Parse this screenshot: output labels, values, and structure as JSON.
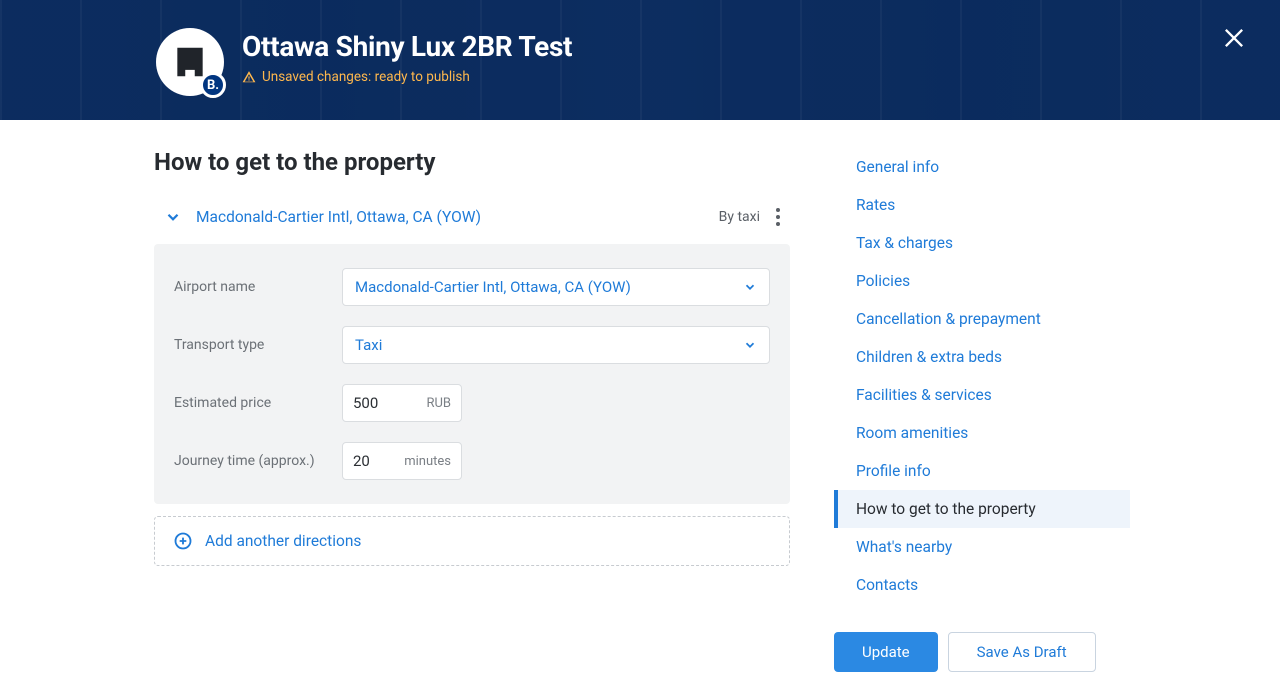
{
  "header": {
    "title": "Ottawa Shiny Lux 2BR Test",
    "status": "Unsaved changes: ready to publish",
    "brand_letter": "B."
  },
  "page": {
    "title": "How to get to the property"
  },
  "direction": {
    "label": "Macdonald-Cartier Intl, Ottawa, CA (YOW)",
    "mode_summary": "By taxi",
    "fields": {
      "airport_label": "Airport name",
      "airport_value": "Macdonald-Cartier Intl, Ottawa, CA (YOW)",
      "transport_label": "Transport type",
      "transport_value": "Taxi",
      "price_label": "Estimated price",
      "price_value": "500",
      "price_unit": "RUB",
      "time_label": "Journey time (approx.)",
      "time_value": "20",
      "time_unit": "minutes"
    }
  },
  "add_label": "Add another directions",
  "nav": {
    "items": [
      "General info",
      "Rates",
      "Tax & charges",
      "Policies",
      "Cancellation & prepayment",
      "Children & extra beds",
      "Facilities & services",
      "Room amenities",
      "Profile info",
      "How to get to the property",
      "What's nearby",
      "Contacts"
    ],
    "active_index": 9
  },
  "actions": {
    "primary": "Update",
    "secondary": "Save As Draft"
  }
}
